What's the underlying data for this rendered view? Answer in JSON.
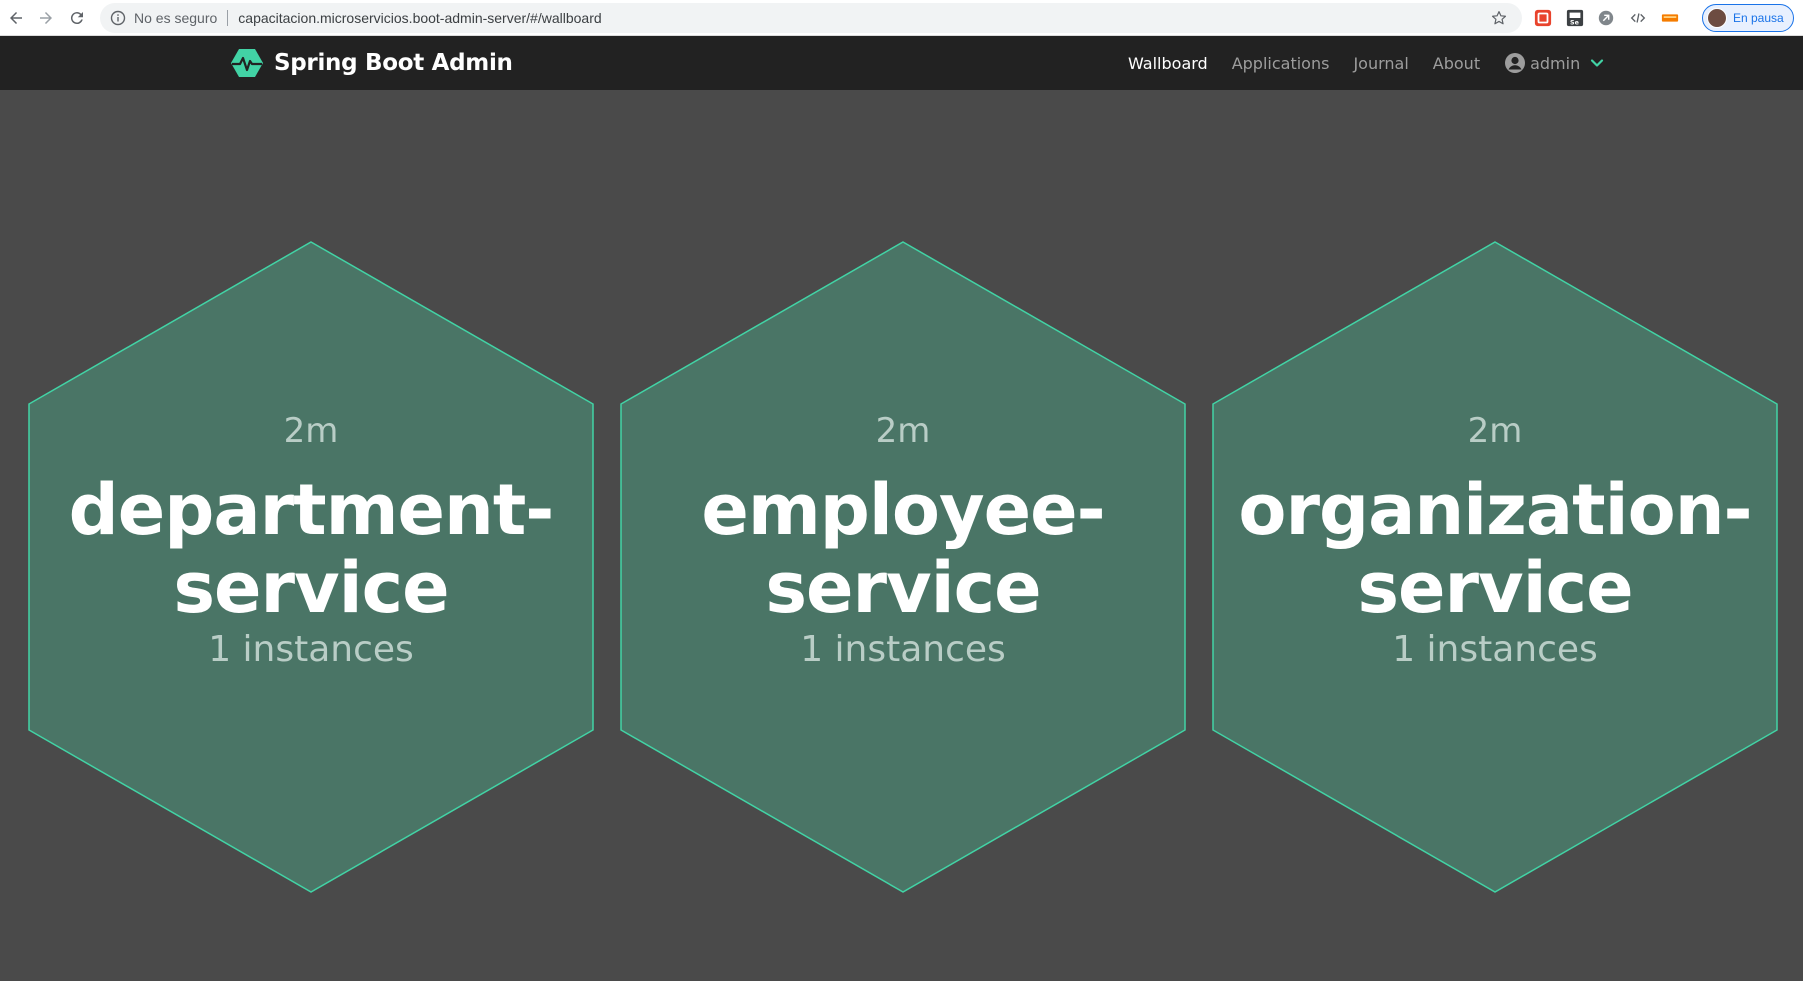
{
  "browser": {
    "security_label": "No es seguro",
    "url": "capacitacion.microservicios.boot-admin-server/#/wallboard",
    "profile_label": "En pausa"
  },
  "navbar": {
    "brand": "Spring Boot Admin",
    "items": [
      {
        "label": "Wallboard",
        "active": true
      },
      {
        "label": "Applications",
        "active": false
      },
      {
        "label": "Journal",
        "active": false
      },
      {
        "label": "About",
        "active": false
      }
    ],
    "user": "admin"
  },
  "colors": {
    "background": "#4a4a4a",
    "navbar": "#222222",
    "hex_fill": "#4a7566",
    "hex_stroke": "#42d3a5",
    "accent": "#42d3a5"
  },
  "applications": [
    {
      "uptime": "2m",
      "name": "department-service",
      "name_line1": "department-",
      "name_line2": "service",
      "instances": "1 instances",
      "status": "UP"
    },
    {
      "uptime": "2m",
      "name": "employee-service",
      "name_line1": "employee-",
      "name_line2": "service",
      "instances": "1 instances",
      "status": "UP"
    },
    {
      "uptime": "2m",
      "name": "organization-service",
      "name_line1": "organization-",
      "name_line2": "service",
      "instances": "1 instances",
      "status": "UP"
    }
  ]
}
